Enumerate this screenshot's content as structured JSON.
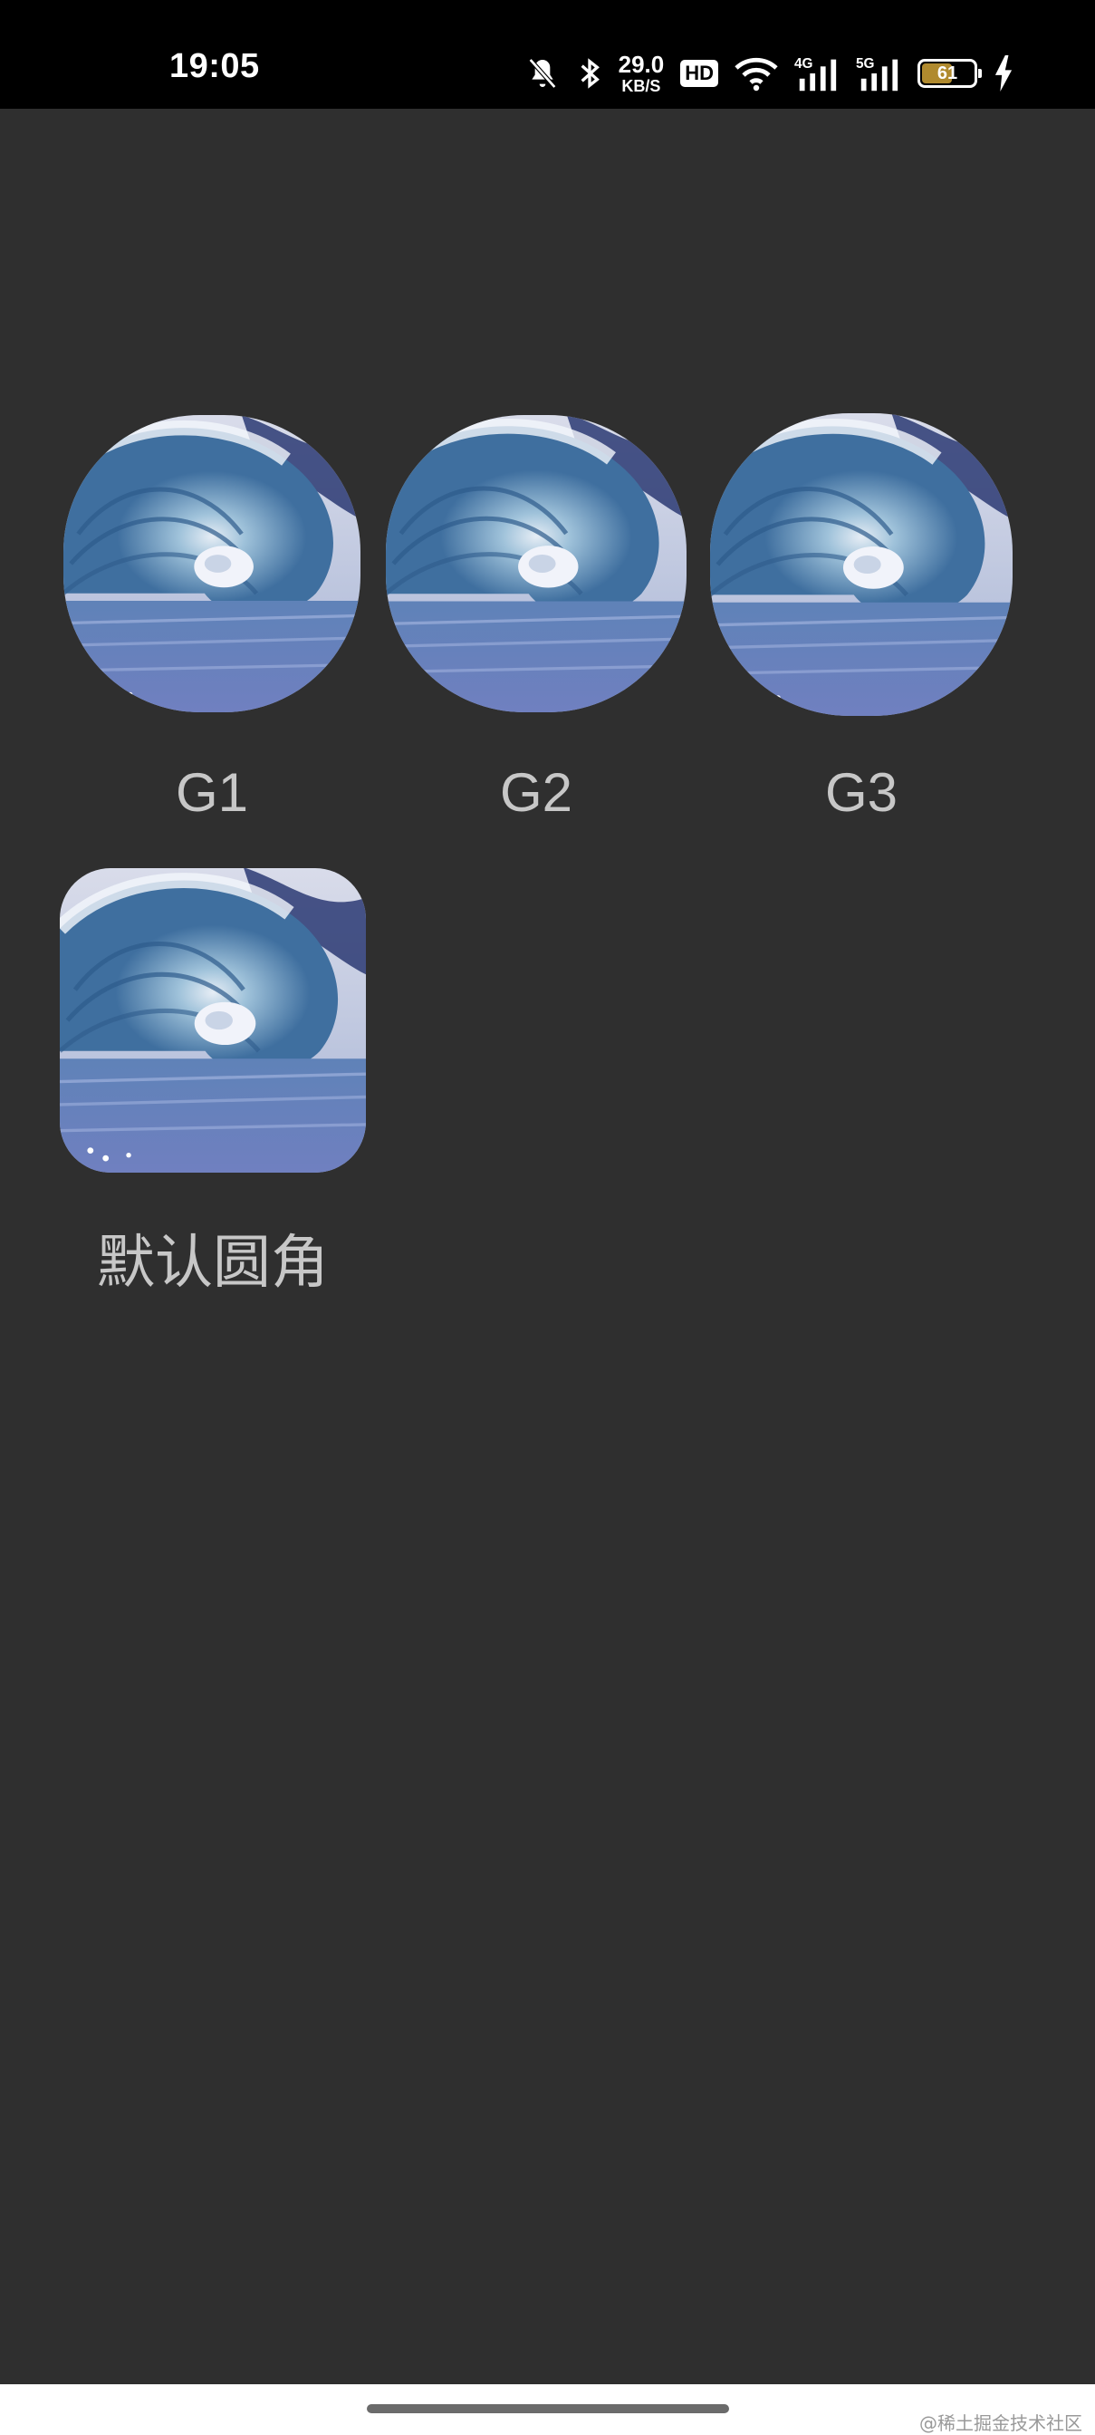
{
  "status_bar": {
    "time": "19:05",
    "net_speed_value": "29.0",
    "net_speed_unit": "KB/S",
    "hd_badge": "HD",
    "signal_1_type": "4G",
    "signal_2_type": "5G",
    "battery_level": "61",
    "battery_fraction": 0.61,
    "icons": [
      "mute-bell-icon",
      "bluetooth-icon",
      "wifi-icon",
      "signal-4g-icon",
      "signal-5g-icon",
      "battery-icon",
      "charging-icon"
    ]
  },
  "tiles": [
    {
      "label": "G1",
      "image": "wave-image"
    },
    {
      "label": "G2",
      "image": "wave-image"
    },
    {
      "label": "G3",
      "image": "wave-image"
    },
    {
      "label": "默认圆角",
      "image": "wave-image"
    }
  ],
  "watermark": "@稀土掘金技术社区",
  "colors": {
    "background": "#2f2f2f",
    "label": "#c7c7c7",
    "status_bar": "#000000",
    "nav_bar": "#ffffff",
    "battery_fill": "#b08a2e"
  }
}
